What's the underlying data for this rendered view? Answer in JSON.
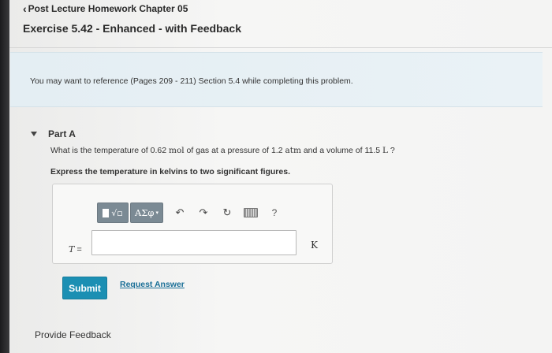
{
  "header": {
    "back_label": "Post Lecture Homework Chapter 05",
    "exercise_title": "Exercise 5.42 - Enhanced - with Feedback"
  },
  "reference": {
    "text": "You may want to reference (Pages 209 - 211) Section 5.4 while completing this problem."
  },
  "part": {
    "label": "Part A",
    "question_prefix": "What is the temperature of 0.62 ",
    "unit_mol": "mol",
    "question_mid1": " of gas at a pressure of 1.2 ",
    "unit_atm": "atm",
    "question_mid2": " and a volume of 11.5 ",
    "unit_L": "L",
    "question_suffix": " ?",
    "instruction": "Express the temperature in kelvins to two significant figures."
  },
  "toolbar": {
    "template_radical": "√▫",
    "greek_label": "ΑΣφ",
    "greek_dropdown": "▾",
    "undo_icon": "↶",
    "redo_icon": "↷",
    "reset_icon": "↻",
    "help_label": "?"
  },
  "answer": {
    "variable": "T",
    "equals": " =",
    "value": "",
    "unit": "K"
  },
  "actions": {
    "submit_label": "Submit",
    "request_answer_label": "Request Answer",
    "provide_feedback_label": "Provide Feedback"
  },
  "colors": {
    "submit_bg": "#1b8fb3",
    "link": "#1a6f97",
    "reference_bg": "#e4eef3",
    "toolbar_btn": "#7b8a94"
  }
}
